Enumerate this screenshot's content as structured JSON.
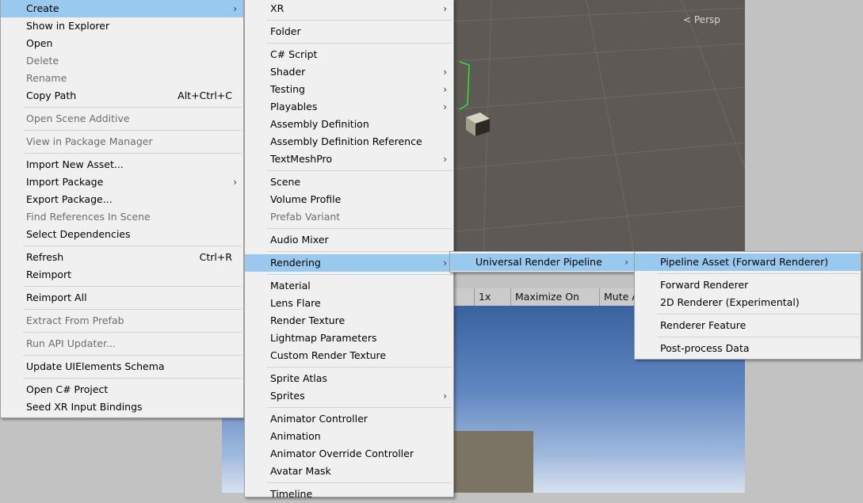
{
  "background": {
    "scene_view_label": "Persp",
    "game_toolbar": {
      "scale": "1x",
      "maximize": "Maximize On Play",
      "mute": "Mute A"
    }
  },
  "menu1": {
    "items": [
      {
        "label": "Create",
        "submenu": true,
        "highlight": true
      },
      {
        "label": "Show in Explorer"
      },
      {
        "label": "Open"
      },
      {
        "label": "Delete",
        "disabled": true
      },
      {
        "label": "Rename",
        "disabled": true
      },
      {
        "label": "Copy Path",
        "shortcut": "Alt+Ctrl+C"
      },
      {
        "sep": true
      },
      {
        "label": "Open Scene Additive",
        "disabled": true
      },
      {
        "sep": true
      },
      {
        "label": "View in Package Manager",
        "disabled": true
      },
      {
        "sep": true
      },
      {
        "label": "Import New Asset..."
      },
      {
        "label": "Import Package",
        "submenu": true
      },
      {
        "label": "Export Package..."
      },
      {
        "label": "Find References In Scene",
        "disabled": true
      },
      {
        "label": "Select Dependencies"
      },
      {
        "sep": true
      },
      {
        "label": "Refresh",
        "shortcut": "Ctrl+R"
      },
      {
        "label": "Reimport"
      },
      {
        "sep": true
      },
      {
        "label": "Reimport All"
      },
      {
        "sep": true
      },
      {
        "label": "Extract From Prefab",
        "disabled": true
      },
      {
        "sep": true
      },
      {
        "label": "Run API Updater...",
        "disabled": true
      },
      {
        "sep": true
      },
      {
        "label": "Update UIElements Schema"
      },
      {
        "sep": true
      },
      {
        "label": "Open C# Project"
      },
      {
        "label": "Seed XR Input Bindings"
      }
    ]
  },
  "menu2": {
    "items": [
      {
        "label": "XR",
        "submenu": true
      },
      {
        "sep": true
      },
      {
        "label": "Folder"
      },
      {
        "sep": true
      },
      {
        "label": "C# Script"
      },
      {
        "label": "Shader",
        "submenu": true
      },
      {
        "label": "Testing",
        "submenu": true
      },
      {
        "label": "Playables",
        "submenu": true
      },
      {
        "label": "Assembly Definition"
      },
      {
        "label": "Assembly Definition Reference"
      },
      {
        "label": "TextMeshPro",
        "submenu": true
      },
      {
        "sep": true
      },
      {
        "label": "Scene"
      },
      {
        "label": "Volume Profile"
      },
      {
        "label": "Prefab Variant",
        "disabled": true
      },
      {
        "sep": true
      },
      {
        "label": "Audio Mixer"
      },
      {
        "sep": true
      },
      {
        "label": "Rendering",
        "submenu": true,
        "highlight": true
      },
      {
        "sep": true
      },
      {
        "label": "Material"
      },
      {
        "label": "Lens Flare"
      },
      {
        "label": "Render Texture"
      },
      {
        "label": "Lightmap Parameters"
      },
      {
        "label": "Custom Render Texture"
      },
      {
        "sep": true
      },
      {
        "label": "Sprite Atlas"
      },
      {
        "label": "Sprites",
        "submenu": true
      },
      {
        "sep": true
      },
      {
        "label": "Animator Controller"
      },
      {
        "label": "Animation"
      },
      {
        "label": "Animator Override Controller"
      },
      {
        "label": "Avatar Mask"
      },
      {
        "sep": true
      },
      {
        "label": "Timeline"
      }
    ]
  },
  "menu3": {
    "items": [
      {
        "label": "Universal Render Pipeline",
        "submenu": true,
        "highlight": true
      }
    ]
  },
  "menu4": {
    "items": [
      {
        "label": "Pipeline Asset (Forward Renderer)",
        "highlight": true
      },
      {
        "sep": true
      },
      {
        "label": "Forward Renderer"
      },
      {
        "label": "2D Renderer (Experimental)"
      },
      {
        "sep": true
      },
      {
        "label": "Renderer Feature"
      },
      {
        "sep": true
      },
      {
        "label": "Post-process Data"
      }
    ]
  },
  "icons": {
    "submenu_arrow": "chevron-right-icon"
  }
}
